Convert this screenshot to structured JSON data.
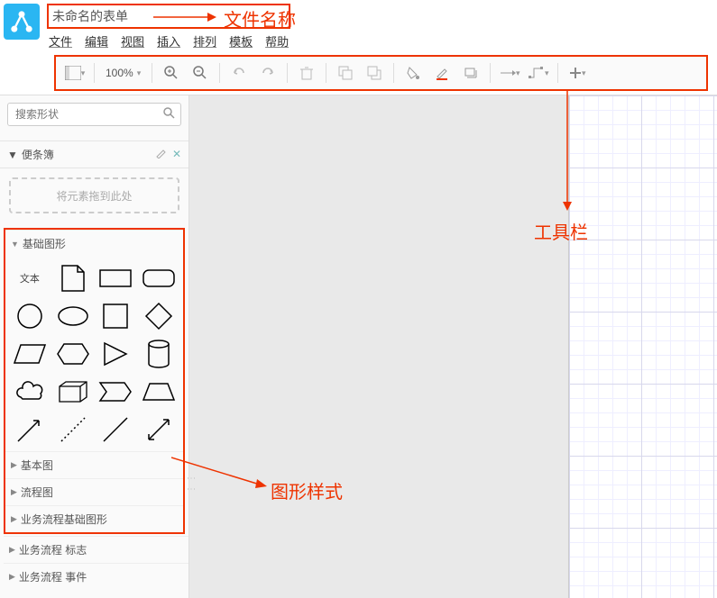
{
  "title": "未命名的表单",
  "menu": {
    "file": "文件",
    "edit": "编辑",
    "view": "视图",
    "insert": "插入",
    "arrange": "排列",
    "template": "模板",
    "help": "帮助"
  },
  "toolbar": {
    "zoom": "100%"
  },
  "search": {
    "placeholder": "搜索形状"
  },
  "scratchpad": {
    "title": "便条簿",
    "drop_hint": "将元素拖到此处"
  },
  "groups": {
    "basic_shapes": "基础图形",
    "basic_fig": "基本图",
    "flowchart": "流程图",
    "biz_flow_basic": "业务流程基础图形",
    "biz_flow_mark": "业务流程 标志",
    "biz_flow_event": "业务流程 事件"
  },
  "shapes": {
    "text_label": "文本"
  },
  "annotations": {
    "filename": "文件名称",
    "toolbar": "工具栏",
    "shapes": "图形样式"
  }
}
